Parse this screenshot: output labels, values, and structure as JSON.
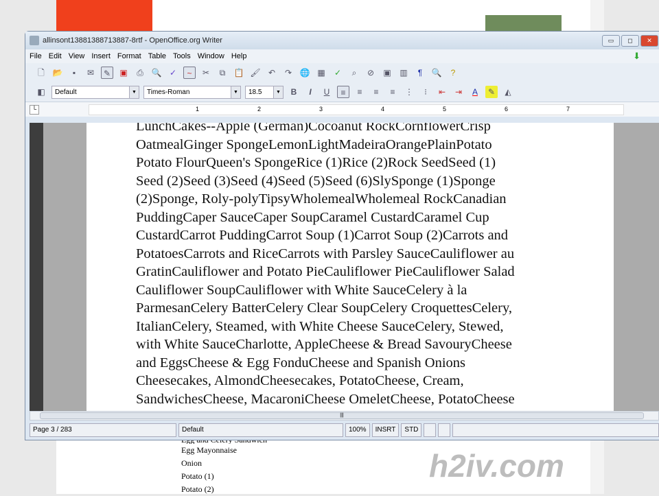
{
  "window": {
    "title": "allinsont13881388713887-8rtf - OpenOffice.org Writer"
  },
  "menu": [
    "File",
    "Edit",
    "View",
    "Insert",
    "Format",
    "Table",
    "Tools",
    "Window",
    "Help"
  ],
  "format_bar": {
    "style": "Default",
    "font": "Times-Roman",
    "size": "18.5",
    "bold": "B",
    "italic": "I",
    "underline": "U"
  },
  "ruler": {
    "marks": [
      "1",
      "2",
      "3",
      "4",
      "5",
      "6",
      "7"
    ]
  },
  "document": {
    "lines": [
      "LunchCakes--Apple (German)Cocoanut RockCornflowerCrisp",
      "OatmealGinger SpongeLemonLightMadeiraOrangePlainPotato",
      "Potato FlourQueen's SpongeRice (1)Rice (2)Rock SeedSeed (1)",
      "Seed (2)Seed (3)Seed (4)Seed (5)Seed (6)SlySponge (1)Sponge",
      "(2)Sponge, Roly-polyTipsyWholemealWholemeal RockCanadian",
      "PuddingCaper SauceCaper SoupCaramel CustardCaramel Cup",
      "CustardCarrot PuddingCarrot Soup (1)Carrot Soup (2)Carrots and",
      "PotatoesCarrots and RiceCarrots with Parsley SauceCauliflower au",
      "GratinCauliflower and Potato PieCauliflower PieCauliflower Salad",
      "Cauliflower SoupCauliflower with White SauceCelery à la",
      "ParmesanCelery BatterCelery Clear SoupCelery CroquettesCelery,",
      "ItalianCelery, Steamed, with White Cheese SauceCelery, Stewed,",
      "with White SauceCharlotte, AppleCheese & Bread SavouryCheese",
      "and EggsCheese & Egg FonduCheese and Spanish Onions",
      "Cheesecakes, AlmondCheesecakes, PotatoCheese, Cream,",
      "SandwichesCheese, MacaroniCheese OmeletCheese, PotatoCheese"
    ]
  },
  "status": {
    "page": "Page 3 / 283",
    "style": "Default",
    "zoom": "100%",
    "mode": "INSRT",
    "sel": "STD"
  },
  "background_list": [
    "Egg and Celery Sandwich",
    "Egg Mayonnaise",
    "Onion",
    "Potato (1)",
    "Potato (2)"
  ],
  "watermark": "h2iv.com"
}
